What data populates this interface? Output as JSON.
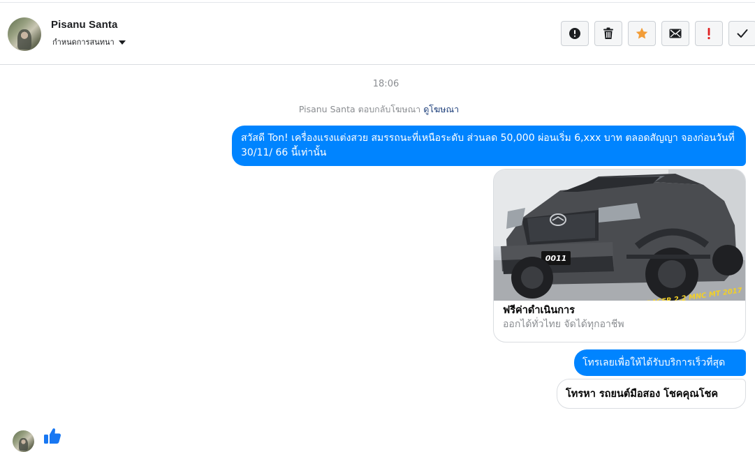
{
  "conversation": {
    "contact_name": "Pisanu Santa",
    "assign_label": "กำหนดการสนทนา"
  },
  "toolbar": {
    "buttons": [
      {
        "name": "report-spam-button",
        "icon": "alert-circle-icon",
        "color": "#1c1e21"
      },
      {
        "name": "delete-button",
        "icon": "trash-icon",
        "color": "#1c1e21"
      },
      {
        "name": "star-button",
        "icon": "star-icon",
        "color": "#f29d38"
      },
      {
        "name": "mark-unread-button",
        "icon": "envelope-icon",
        "color": "#1c1e21"
      },
      {
        "name": "follow-up-button",
        "icon": "exclamation-icon",
        "color": "#e02020"
      },
      {
        "name": "mark-done-button",
        "icon": "checkmark-icon",
        "color": "#1c1e21"
      }
    ]
  },
  "thread": {
    "timestamp": "18:06",
    "reply_note": "Pisanu Santa ตอบกลับโฆษณา",
    "view_ad_link": "ดูโฆษณา",
    "message_1": "สวัสดี Ton! เครื่องแรงแต่งสวย สมรรถนะที่เหนือระดับ ส่วนลด 50,000 ผ่อนเริ่ม 6,xxx บาท ตลอดสัญญา จองก่อนวันที่ 30/11/ 66 นี้เท่านั้น",
    "ad_card": {
      "plate_text": "0011",
      "banner_text": "BT-50 PRO HI-RACER 2.2 MNC MT 2017",
      "title": "ฟรีค่าดำเนินการ",
      "subtitle": "ออกได้ทั่วไทย จัดได้ทุกอาชีพ"
    },
    "message_2": "โทรเลยเพื่อให้ได้รับบริการเร็วที่สุด",
    "quick_reply": "โทรหา รถยนต์มือสอง โชคคุณโชค"
  },
  "colors": {
    "accent_blue": "#0084ff",
    "like_blue": "#1877f2"
  }
}
